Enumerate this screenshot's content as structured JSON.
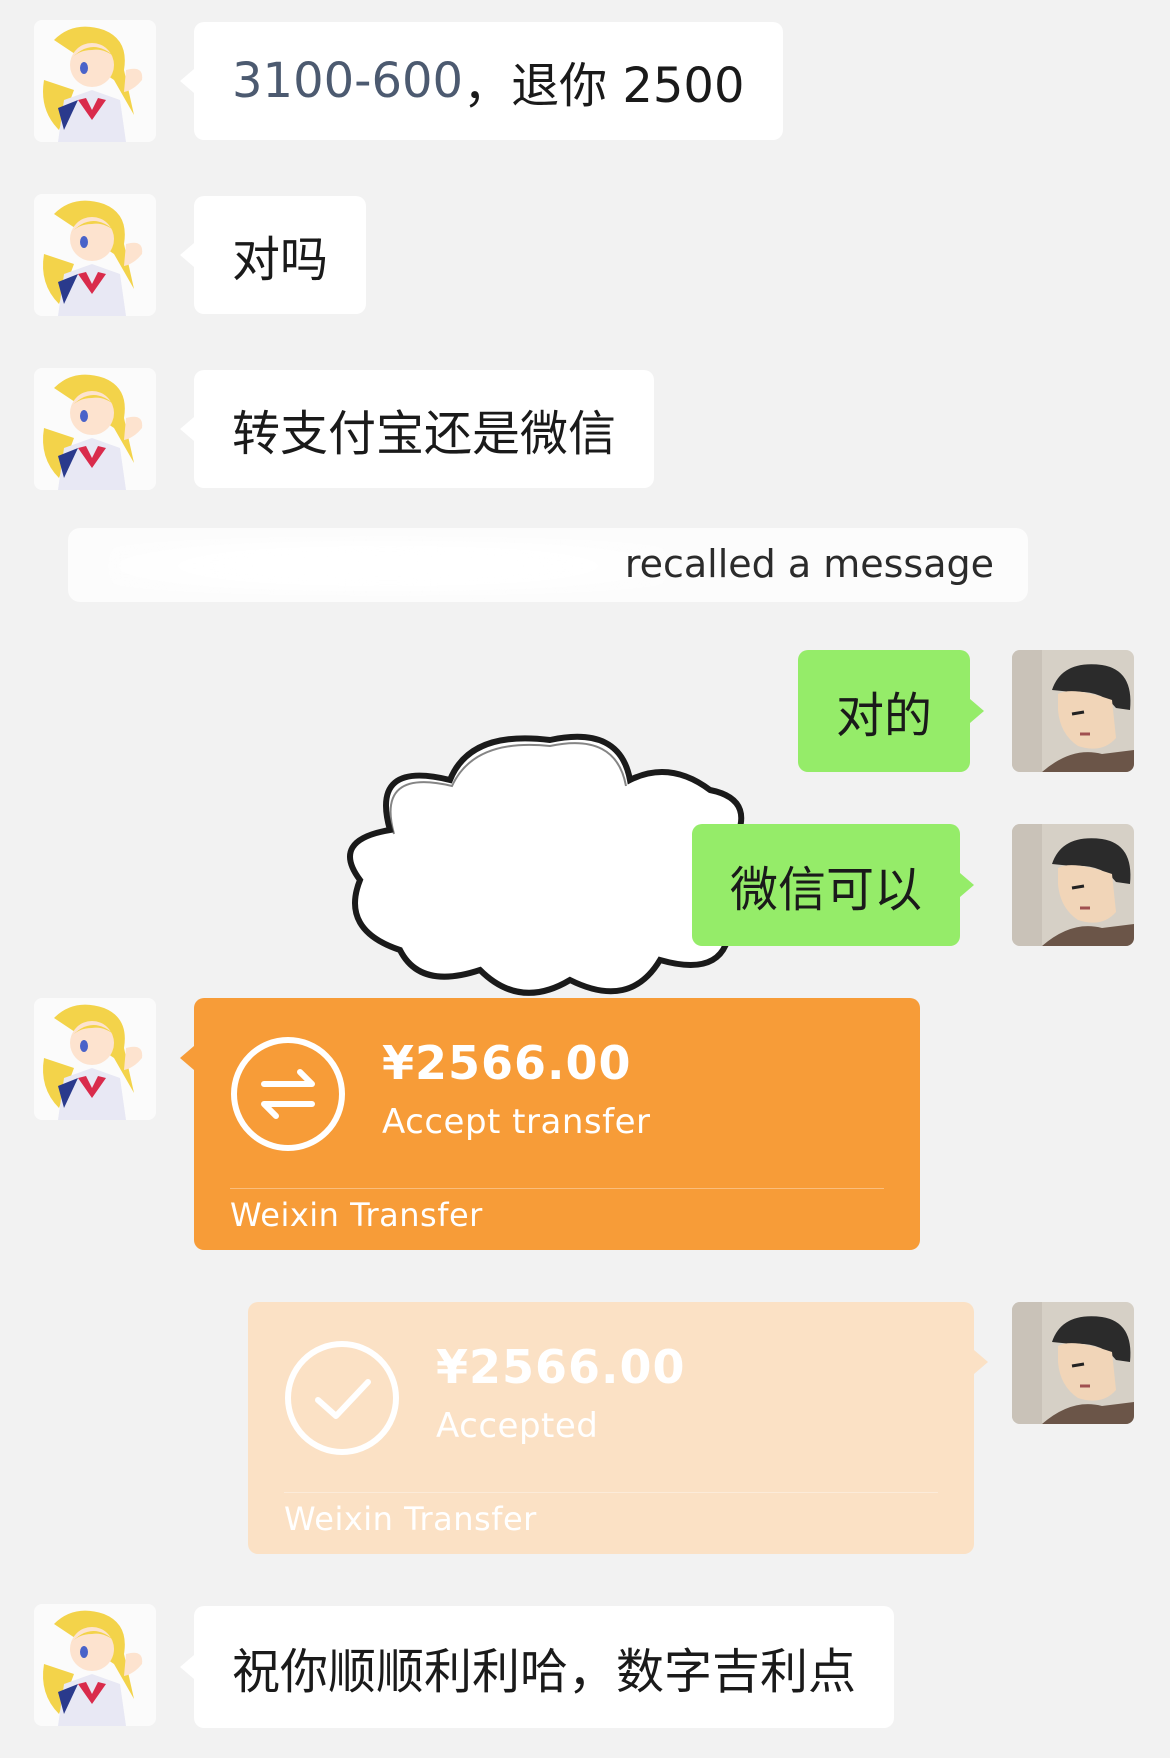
{
  "messages": {
    "m1": {
      "number_part": "3100-600",
      "rest": "，退你 2500"
    },
    "m2": {
      "text": "对吗"
    },
    "m3": {
      "text": "转支付宝还是微信"
    },
    "system_note": {
      "text": "recalled a message"
    },
    "m4": {
      "text": "对的"
    },
    "m5": {
      "text": "微信可以"
    },
    "transfer_pending": {
      "amount": "¥2566.00",
      "status": "Accept transfer",
      "footer": "Weixin Transfer",
      "icon": "transfer-arrows-icon",
      "color": "#f79c38"
    },
    "transfer_accepted": {
      "amount": "¥2566.00",
      "status": "Accepted",
      "footer": "Weixin Transfer",
      "icon": "checkmark-icon",
      "color": "#fbe1c5"
    },
    "m6": {
      "text": "祝你顺顺利利哈，数字吉利点"
    }
  },
  "colors": {
    "background": "#f2f2f2",
    "incoming_bubble": "#ffffff",
    "outgoing_bubble": "#95ec69"
  }
}
